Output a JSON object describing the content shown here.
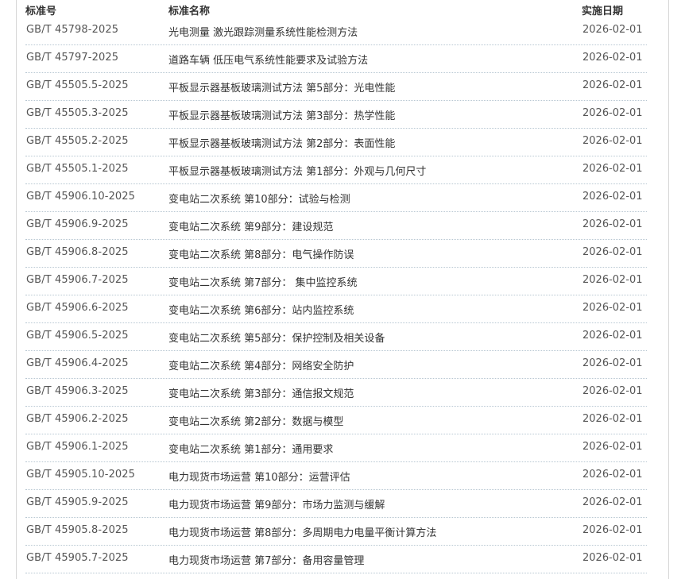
{
  "table": {
    "headers": {
      "code": "标准号",
      "name": "标准名称",
      "date": "实施日期"
    },
    "rows": [
      {
        "code": "GB/T 45798-2025",
        "name": "光电测量 激光跟踪测量系统性能检测方法",
        "date": "2026-02-01"
      },
      {
        "code": "GB/T 45797-2025",
        "name": "道路车辆 低压电气系统性能要求及试验方法",
        "date": "2026-02-01"
      },
      {
        "code": "GB/T 45505.5-2025",
        "name": "平板显示器基板玻璃测试方法 第5部分：光电性能",
        "date": "2026-02-01"
      },
      {
        "code": "GB/T 45505.3-2025",
        "name": "平板显示器基板玻璃测试方法 第3部分：热学性能",
        "date": "2026-02-01"
      },
      {
        "code": "GB/T 45505.2-2025",
        "name": "平板显示器基板玻璃测试方法 第2部分：表面性能",
        "date": "2026-02-01"
      },
      {
        "code": "GB/T 45505.1-2025",
        "name": "平板显示器基板玻璃测试方法 第1部分：外观与几何尺寸",
        "date": "2026-02-01"
      },
      {
        "code": "GB/T 45906.10-2025",
        "name": "变电站二次系统 第10部分：试验与检测",
        "date": "2026-02-01"
      },
      {
        "code": "GB/T 45906.9-2025",
        "name": "变电站二次系统 第9部分：建设规范",
        "date": "2026-02-01"
      },
      {
        "code": "GB/T 45906.8-2025",
        "name": "变电站二次系统 第8部分：电气操作防误",
        "date": "2026-02-01"
      },
      {
        "code": "GB/T 45906.7-2025",
        "name": "变电站二次系统 第7部分： 集中监控系统",
        "date": "2026-02-01"
      },
      {
        "code": "GB/T 45906.6-2025",
        "name": "变电站二次系统 第6部分：站内监控系统",
        "date": "2026-02-01"
      },
      {
        "code": "GB/T 45906.5-2025",
        "name": "变电站二次系统 第5部分：保护控制及相关设备",
        "date": "2026-02-01"
      },
      {
        "code": "GB/T 45906.4-2025",
        "name": "变电站二次系统 第4部分：网络安全防护",
        "date": "2026-02-01"
      },
      {
        "code": "GB/T 45906.3-2025",
        "name": "变电站二次系统 第3部分：通信报文规范",
        "date": "2026-02-01"
      },
      {
        "code": "GB/T 45906.2-2025",
        "name": "变电站二次系统 第2部分：数据与模型",
        "date": "2026-02-01"
      },
      {
        "code": "GB/T 45906.1-2025",
        "name": "变电站二次系统 第1部分：通用要求",
        "date": "2026-02-01"
      },
      {
        "code": "GB/T 45905.10-2025",
        "name": "电力现货市场运营 第10部分：运营评估",
        "date": "2026-02-01"
      },
      {
        "code": "GB/T 45905.9-2025",
        "name": "电力现货市场运营 第9部分：市场力监测与缓解",
        "date": "2026-02-01"
      },
      {
        "code": "GB/T 45905.8-2025",
        "name": "电力现货市场运营 第8部分：多周期电力电量平衡计算方法",
        "date": "2026-02-01"
      },
      {
        "code": "GB/T 45905.7-2025",
        "name": "电力现货市场运营 第7部分：备用容量管理",
        "date": "2026-02-01"
      }
    ]
  }
}
